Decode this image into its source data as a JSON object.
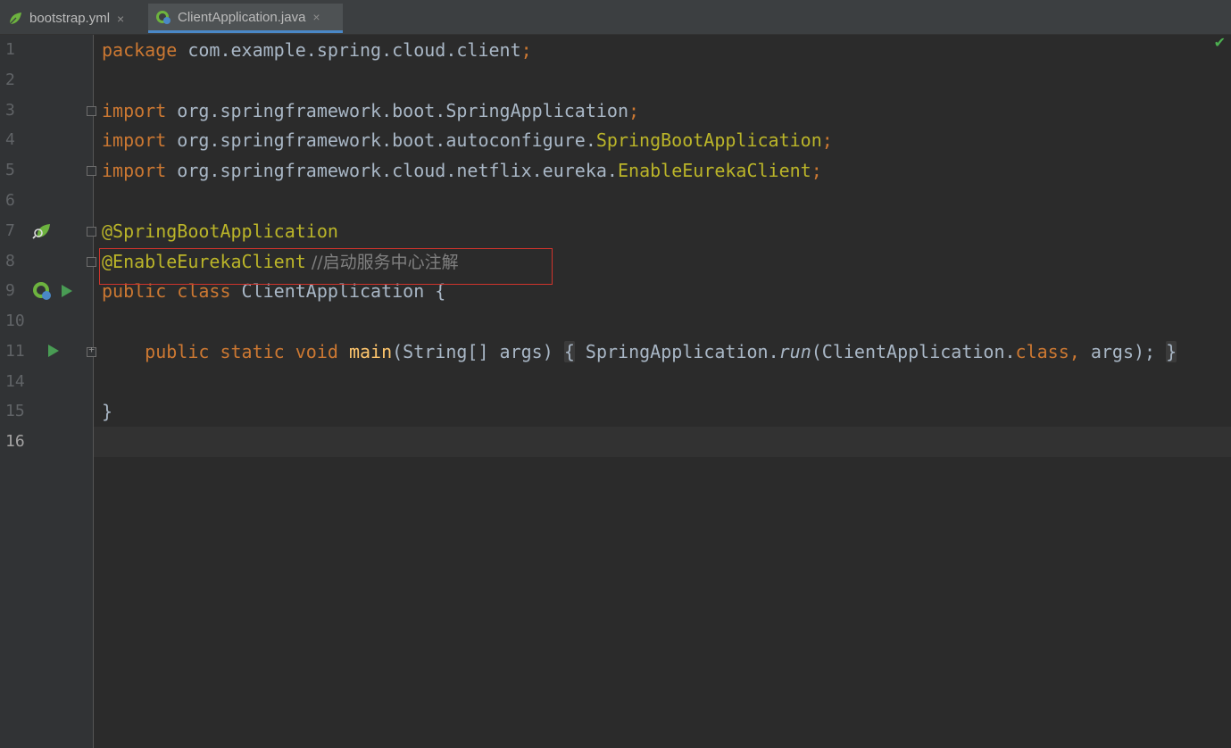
{
  "tabs": [
    {
      "label": "bootstrap.yml",
      "icon": "spring-leaf-icon",
      "active": false
    },
    {
      "label": "ClientApplication.java",
      "icon": "spring-class-icon",
      "active": true
    }
  ],
  "tab_close_glyph": "×",
  "status": {
    "check_glyph": "✔",
    "color": "#4caf50"
  },
  "gutter": {
    "line_numbers": [
      "1",
      "2",
      "3",
      "4",
      "5",
      "6",
      "7",
      "8",
      "9",
      "10",
      "11",
      "14",
      "15",
      "16"
    ],
    "current_line": "16"
  },
  "code": {
    "l1": {
      "kw": "package",
      "rest": " com.example.spring.cloud.client",
      "semi": ";"
    },
    "l3": {
      "kw": "import",
      "rest": " org.springframework.boot.SpringApplication",
      "semi": ";"
    },
    "l4": {
      "kw": "import",
      "rest": " org.springframework.boot.autoconfigure.",
      "cls": "SpringBootApplication",
      "semi": ";"
    },
    "l5": {
      "kw": "import",
      "rest": " org.springframework.cloud.netflix.eureka.",
      "cls": "EnableEurekaClient",
      "semi": ";"
    },
    "l7": {
      "ann": "@SpringBootApplication"
    },
    "l8": {
      "ann": "@EnableEurekaClient",
      "comment": " //启动服务中心注解"
    },
    "l9": {
      "kw": "public class",
      "rest": " ClientApplication {"
    },
    "l11": {
      "kw": "public static void",
      "fn": "main",
      "params": "(String[] args)",
      "open": "{",
      "call": " SpringApplication.",
      "run": "run",
      "args_open": "(ClientApplication.",
      "class_kw": "class",
      "comma": ",",
      "args_rest": " args);",
      "close": "}"
    },
    "l15": {
      "close": "}"
    }
  },
  "colors": {
    "keyword": "#cc7832",
    "annotation": "#bbb529",
    "text": "#a9b7c6",
    "method": "#ffc66d",
    "comment": "#808080",
    "highlight_box": "#d0342c"
  }
}
